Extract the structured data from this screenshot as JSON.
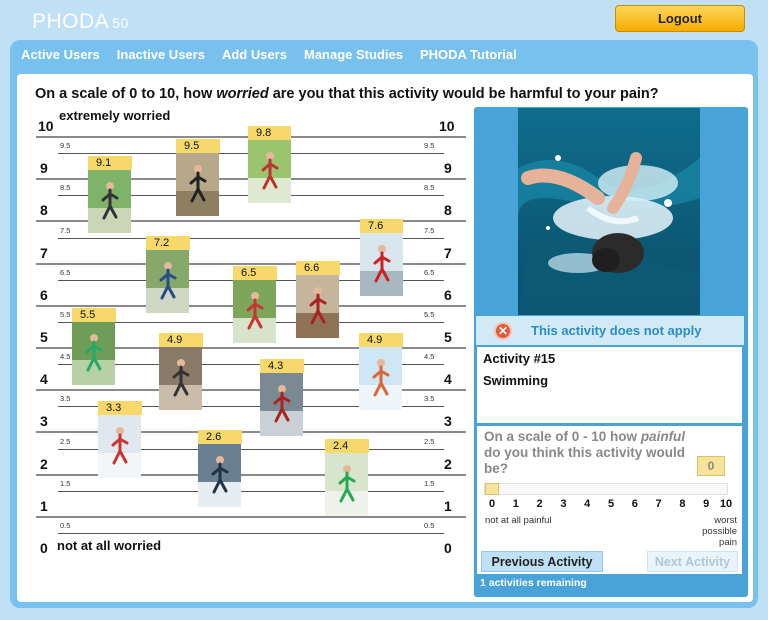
{
  "app": {
    "brand": "PHODA",
    "version": "50"
  },
  "header": {
    "logout_label": "Logout"
  },
  "nav": {
    "items": [
      {
        "label": "Active Users"
      },
      {
        "label": "Inactive Users"
      },
      {
        "label": "Add Users"
      },
      {
        "label": "Manage Studies"
      },
      {
        "label": "PHODA Tutorial"
      }
    ]
  },
  "question": {
    "prefix": "On a scale of 0 to 10, how ",
    "emphasis": "worried",
    "suffix": " are you that this activity would be harmful to your pain?"
  },
  "scale": {
    "top_label": "extremely worried",
    "bottom_label": "not at all worried",
    "major": [
      "10",
      "9",
      "8",
      "7",
      "6",
      "5",
      "4",
      "3",
      "2",
      "1",
      "0"
    ],
    "minor": [
      "9.5",
      "8.5",
      "7.5",
      "6.5",
      "5.5",
      "4.5",
      "3.5",
      "2.5",
      "1.5",
      "0.5"
    ]
  },
  "rated_activities": [
    {
      "rating": "9.1",
      "icon": "running-photo"
    },
    {
      "rating": "9.5",
      "icon": "jumping-photo"
    },
    {
      "rating": "9.8",
      "icon": "soccer-kick-photo"
    },
    {
      "rating": "7.2",
      "icon": "kids-soccer-photo"
    },
    {
      "rating": "6.5",
      "icon": "running-photo"
    },
    {
      "rating": "6.6",
      "icon": "aerobics-photo"
    },
    {
      "rating": "7.6",
      "icon": "pushup-photo"
    },
    {
      "rating": "5.5",
      "icon": "field-sports-photo"
    },
    {
      "rating": "4.9",
      "icon": "walking-photo"
    },
    {
      "rating": "4.3",
      "icon": "cycling-photo"
    },
    {
      "rating": "4.9",
      "icon": "jumping-photo"
    },
    {
      "rating": "3.3",
      "icon": "balance-beam-photo"
    },
    {
      "rating": "2.6",
      "icon": "skiing-photo"
    },
    {
      "rating": "2.4",
      "icon": "tennis-photo"
    }
  ],
  "current_activity": {
    "photo_icon": "swimming-photo",
    "not_apply_label": "This activity does not apply",
    "number_label": "Activity #15",
    "name": "Swimming"
  },
  "pain": {
    "question_prefix": "On a scale of 0 - 10 how ",
    "question_emphasis": "painful",
    "question_suffix": " do you think this activity would be?",
    "value": "0",
    "slider_value": 0,
    "ticks": [
      "0",
      "1",
      "2",
      "3",
      "4",
      "5",
      "6",
      "7",
      "8",
      "9",
      "10"
    ],
    "low_label": "not at all painful",
    "high_label": "worst possible pain"
  },
  "footer": {
    "prev_label": "Previous Activity",
    "next_label": "Next Activity",
    "remaining": "1 activities remaining"
  },
  "colors": {
    "accent": "#78c1ee",
    "badge": "#f7d96b",
    "logout": "#f5ad00",
    "warning": "#e05a3c"
  }
}
